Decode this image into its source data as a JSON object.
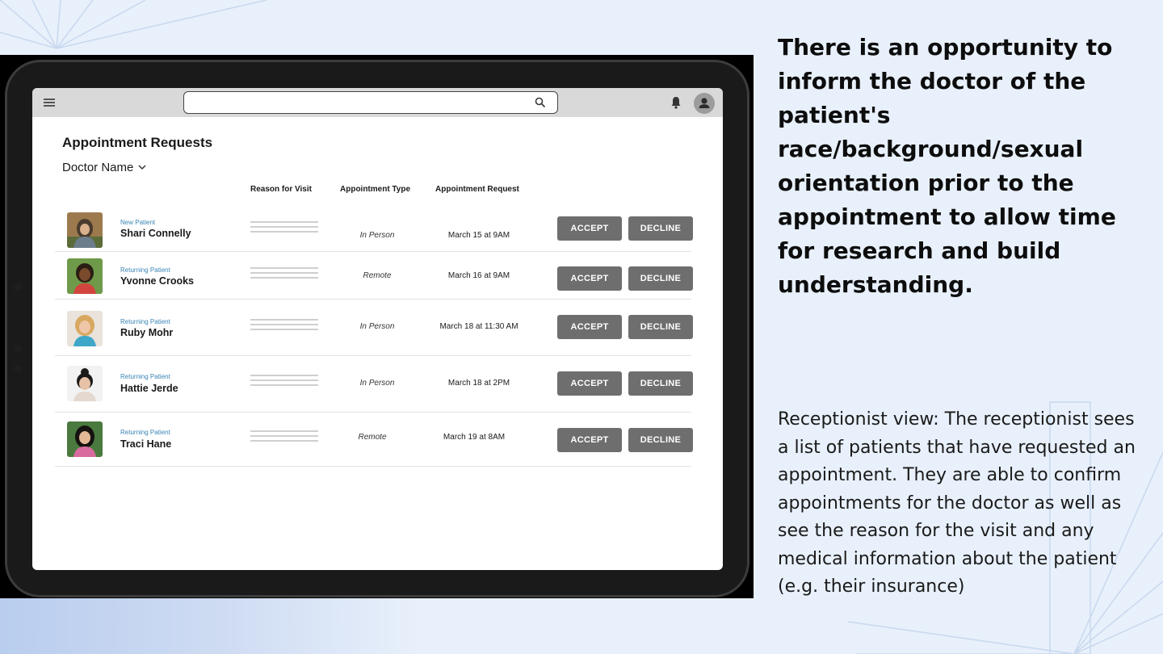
{
  "screen": {
    "search": {
      "value": "",
      "placeholder": ""
    },
    "title": "Appointment Requests",
    "doctor_select": "Doctor Name",
    "columns": {
      "reason": "Reason for Visit",
      "type": "Appointment Type",
      "request": "Appointment Request"
    },
    "accept_label": "ACCEPT",
    "decline_label": "DECLINE",
    "patients": [
      {
        "status": "New Patient",
        "name": "Shari Connelly",
        "appt_type": "In Person",
        "request": "March 15 at 9AM"
      },
      {
        "status": "Returning Patient",
        "name": "Yvonne Crooks",
        "appt_type": "Remote",
        "request": "March 16 at 9AM"
      },
      {
        "status": "Returning Patient",
        "name": "Ruby Mohr",
        "appt_type": "In Person",
        "request": "March 18 at 11:30 AM"
      },
      {
        "status": "Returning Patient",
        "name": "Hattie Jerde",
        "appt_type": "In Person",
        "request": "March 18 at 2PM"
      },
      {
        "status": "Returning Patient",
        "name": "Traci Hane",
        "appt_type": "Remote",
        "request": "March 19 at 8AM"
      }
    ]
  },
  "annotation": {
    "headline": "There is an opportunity to inform the doctor of the patient's race/background/sexual orientation prior to the appointment to allow time for research and build understanding.",
    "description": "Receptionist view: The receptionist sees a list of patients that have requested an appointment. They are able to confirm appointments for the doctor as well as see the reason for the visit and any medical information about the patient (e.g. their insurance)"
  },
  "icons": [
    "menu-icon",
    "search-icon",
    "bell-icon",
    "user-icon",
    "chevron-down-icon"
  ],
  "colors": {
    "background": "#e8f0fb",
    "button": "#6e6e6e",
    "patient_status": "#3a84b5",
    "topbar": "#d9d9d9"
  }
}
